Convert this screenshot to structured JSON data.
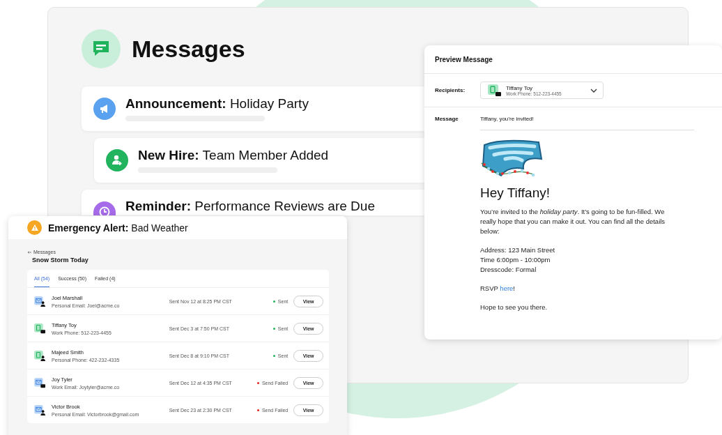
{
  "messages_panel": {
    "title": "Messages",
    "cards": [
      {
        "kind": "announcement",
        "label": "Announcement:",
        "title": "Holiday Party"
      },
      {
        "kind": "new_hire",
        "label": "New Hire:",
        "title": "Team Member Added"
      },
      {
        "kind": "reminder",
        "label": "Reminder:",
        "title": "Performance Reviews are Due"
      }
    ]
  },
  "preview": {
    "title": "Preview Message",
    "recipients_label": "Recipients:",
    "recipient": {
      "name": "Tiffany Toy",
      "detail": "Work Phone: 512-223-4455",
      "kind": "phone_work"
    },
    "message_label": "Message",
    "subject": "Tiffany, you’re invited!",
    "greeting": "Hey Tiffany!",
    "body": "You’re invited to the *holiday party*. It’s going to be fun-filled. We really hope that you can make it out. You can find all the details below:",
    "details": [
      "Address: 123 Main Street",
      "Time 6:00pm - 10:00pm",
      "Dresscode: Formal"
    ],
    "rsvp": {
      "prefix": "RSVP",
      "link": "here",
      "suffix": "!"
    },
    "closing": "Hope to see you there."
  },
  "alert_window": {
    "kind": "emergency",
    "label": "Emergency Alert:",
    "title": "Bad Weather",
    "back": "Messages",
    "heading": "Snow Storm Today",
    "tabs": [
      {
        "label": "All (54)",
        "selected": true
      },
      {
        "label": "Success (50)",
        "selected": false
      },
      {
        "label": "Failed (4)",
        "selected": false
      }
    ],
    "rows": [
      {
        "name": "Joel Marshall",
        "detail": "Personal Email: Joel@acme.co",
        "kind": "email_personal",
        "sent": "Sent Nov 12 at 8:25 PM CST",
        "status": "Sent",
        "failed": false,
        "action": "View"
      },
      {
        "name": "Tiffany Toy",
        "detail": "Work Phone: 512-223-4455",
        "kind": "phone_work",
        "sent": "Sent Dec 3 at 7:50 PM CST",
        "status": "Sent",
        "failed": false,
        "action": "View"
      },
      {
        "name": "Majeed Smith",
        "detail": "Personal Phone: 422-232-4335",
        "kind": "phone_personal",
        "sent": "Sent Dec 8 at 9:10 PM CST",
        "status": "Sent",
        "failed": false,
        "action": "View"
      },
      {
        "name": "Joy Tyler",
        "detail": "Work Email: Joytyler@acme.co",
        "kind": "email_work",
        "sent": "Sent Dec 12 at 4:35 PM CST",
        "status": "Send Failed",
        "failed": true,
        "action": "View"
      },
      {
        "name": "Victor Brook",
        "detail": "Personal Email: Victorbrook@gmail.com",
        "kind": "email_personal",
        "sent": "Sent Dec 23 at 2:30 PM CST",
        "status": "Send Failed",
        "failed": true,
        "action": "View"
      }
    ]
  }
}
